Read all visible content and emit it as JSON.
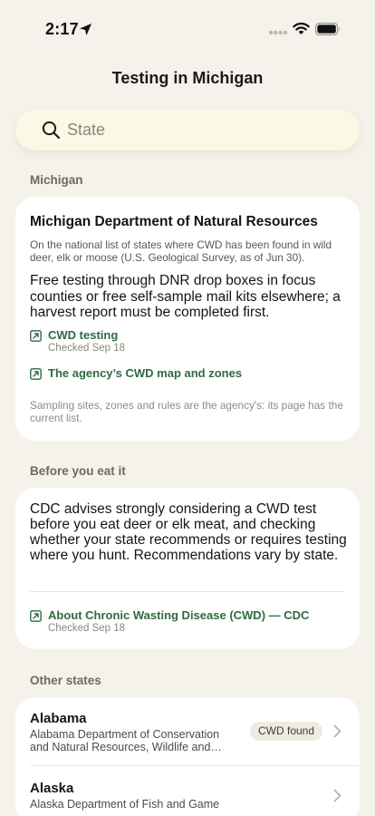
{
  "status_bar": {
    "time": "2:17",
    "location_icon": "location-arrow-icon",
    "signal_icon": "signal-dots-icon",
    "wifi_icon": "wifi-icon",
    "battery_icon": "battery-icon"
  },
  "header": {
    "title": "Testing in Michigan"
  },
  "search": {
    "placeholder": "State",
    "value": "",
    "icon": "search-icon"
  },
  "michigan": {
    "section_label": "Michigan",
    "agency_name": "Michigan Department of Natural Resources",
    "note": "On the national list of states where CWD has been found in wild deer, elk or moose (U.S. Geological Survey, as of Jun 30).",
    "testing_info": "Free testing through DNR drop boxes in focus counties or free self-sample mail kits elsewhere; a harvest report must be completed first.",
    "links": [
      {
        "label": "CWD testing",
        "checked": "Checked Sep 18",
        "icon": "external-link-icon"
      },
      {
        "label": "The agency’s CWD map and zones",
        "icon": "external-link-icon"
      }
    ],
    "footnote": "Sampling sites, zones and rules are the agency's: its page has the current list."
  },
  "before_you_eat": {
    "section_label": "Before you eat it",
    "text": "CDC advises strongly considering a CWD test before you eat deer or elk meat, and checking whether your state recommends or requires testing where you hunt. Recommendations vary by state.",
    "link": {
      "label": "About Chronic Wasting Disease (CWD) — CDC",
      "checked": "Checked Sep 18",
      "icon": "external-link-icon"
    }
  },
  "other_states": {
    "section_label": "Other states",
    "items": [
      {
        "name": "Alabama",
        "agency": "Alabama Department of Conservation and Natural Resources, Wildlife and…",
        "badge": "CWD found"
      },
      {
        "name": "Alaska",
        "agency": "Alaska Department of Fish and Game",
        "badge": ""
      }
    ]
  },
  "colors": {
    "background": "#f5f2eb",
    "card": "#ffffff",
    "search_bg": "#fcf8e6",
    "link_green": "#2f6a44",
    "section_label": "#6e6a62"
  }
}
